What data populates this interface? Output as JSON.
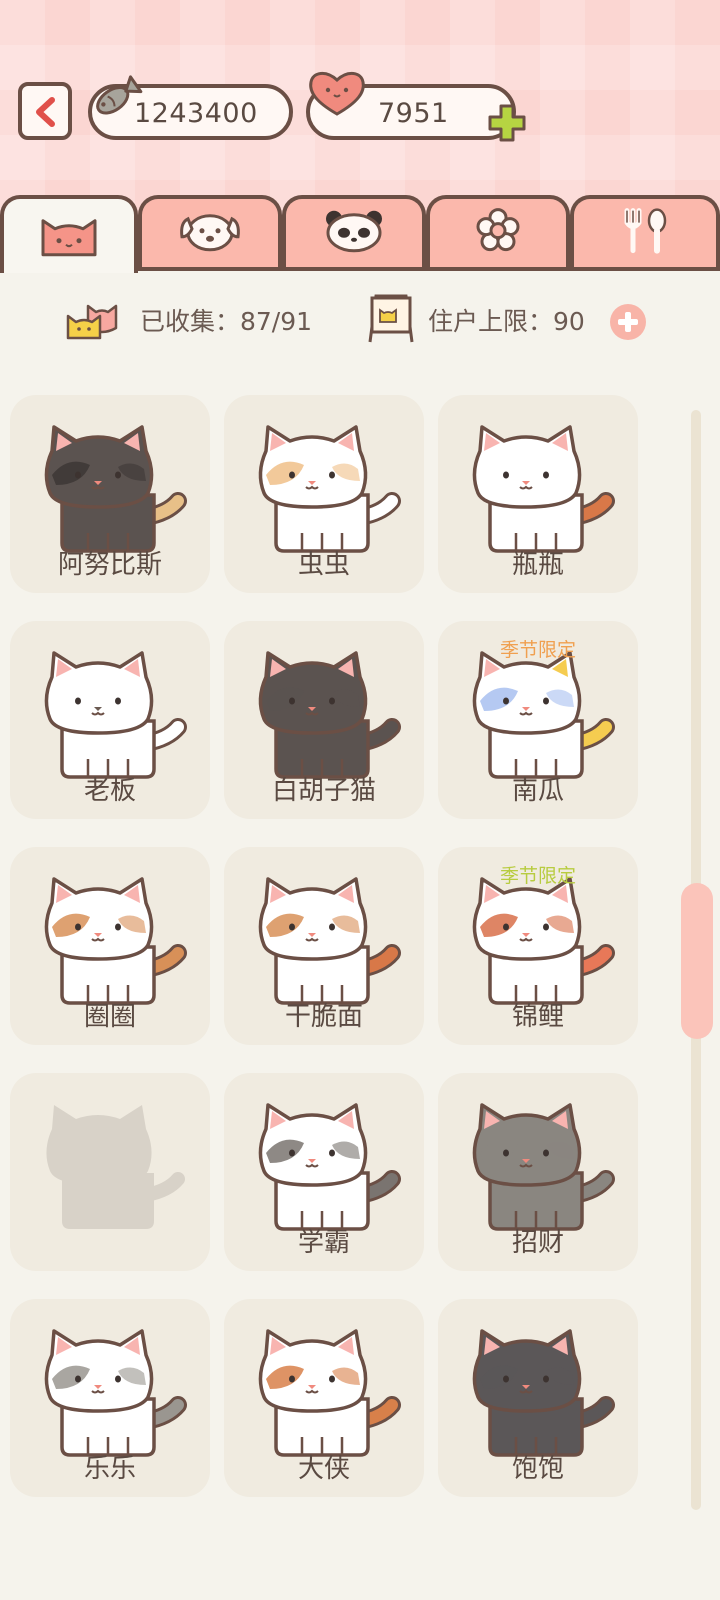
{
  "header": {
    "fish_count": "1243400",
    "heart_count": "7951",
    "back_icon": "chevron-left-icon",
    "fish_icon": "fish-icon",
    "heart_icon": "heart-icon",
    "add_icon": "plus-icon"
  },
  "tabs": [
    {
      "icon": "cat-face-icon",
      "active": true
    },
    {
      "icon": "dog-face-icon",
      "active": false
    },
    {
      "icon": "panda-face-icon",
      "active": false
    },
    {
      "icon": "flower-icon",
      "active": false
    },
    {
      "icon": "fork-spoon-icon",
      "active": false
    }
  ],
  "stats": {
    "collected": "已收集：87/91",
    "resident_limit": "住户上限：90"
  },
  "cats": [
    {
      "name": "阿努比斯",
      "badge": "",
      "locked": false
    },
    {
      "name": "虫虫",
      "badge": "",
      "locked": false
    },
    {
      "name": "瓶瓶",
      "badge": "",
      "locked": false
    },
    {
      "name": "老板",
      "badge": "",
      "locked": false
    },
    {
      "name": "白胡子猫",
      "badge": "",
      "locked": false
    },
    {
      "name": "南瓜",
      "badge": "季节限定",
      "locked": false
    },
    {
      "name": "圈圈",
      "badge": "",
      "locked": false
    },
    {
      "name": "干脆面",
      "badge": "",
      "locked": false
    },
    {
      "name": "锦鲤",
      "badge": "季节限定",
      "locked": false
    },
    {
      "name": "",
      "badge": "",
      "locked": true
    },
    {
      "name": "学霸",
      "badge": "",
      "locked": false
    },
    {
      "name": "招财",
      "badge": "",
      "locked": false
    },
    {
      "name": "乐乐",
      "badge": "",
      "locked": false
    },
    {
      "name": "大侠",
      "badge": "",
      "locked": false
    },
    {
      "name": "饱饱",
      "badge": "",
      "locked": false
    }
  ],
  "colors": {
    "accent": "#fbb8ac",
    "outline": "#6b4f45",
    "badge_orange": "#f0a050",
    "badge_green": "#b8cc40"
  }
}
